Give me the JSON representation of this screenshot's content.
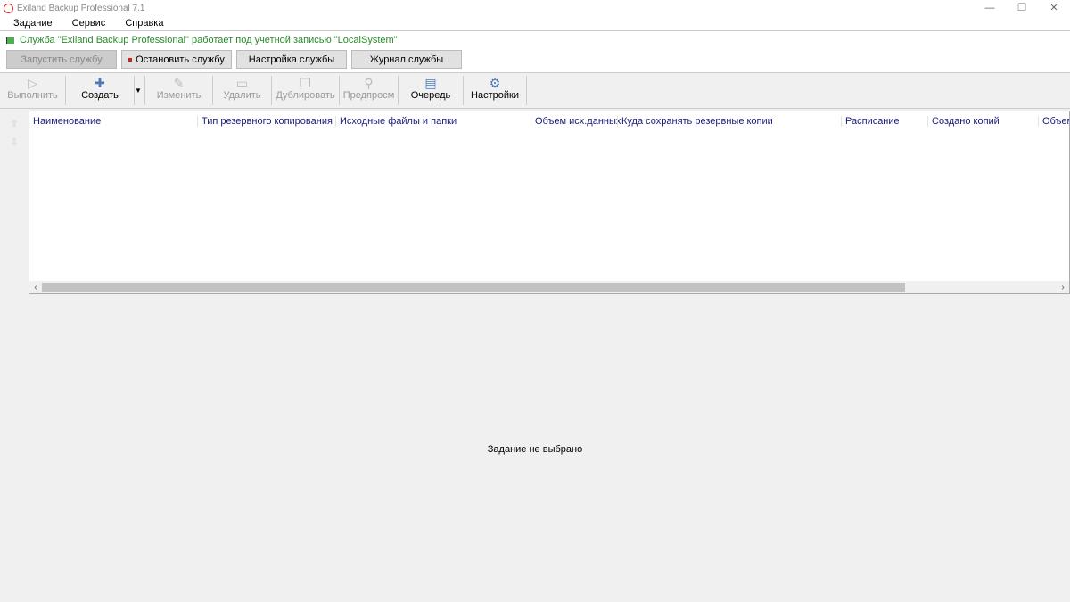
{
  "window": {
    "title": "Exiland Backup Professional 7.1",
    "controls": [
      "—",
      "❐",
      "✕"
    ]
  },
  "menu": [
    "Задание",
    "Сервис",
    "Справка"
  ],
  "service": {
    "message": "Служба \"Exiland Backup Professional\" работает под учетной записью \"LocalSystem\"",
    "buttons": {
      "start": "Запустить службу",
      "stop": "Остановить службу",
      "settings": "Настройка службы",
      "log": "Журнал службы"
    },
    "status_color": "#2a8a2a"
  },
  "toolbar": [
    {
      "label": "Выполнить",
      "icon": "▷",
      "enabled": false
    },
    {
      "label": "Создать",
      "icon": "✚",
      "enabled": true
    },
    {
      "label": "Изменить",
      "icon": "✎",
      "enabled": false
    },
    {
      "label": "Удалить",
      "icon": "▭",
      "enabled": false
    },
    {
      "label": "Дублировать",
      "icon": "❐",
      "enabled": false
    },
    {
      "label": "Предпросм",
      "icon": "⚲",
      "enabled": false
    },
    {
      "label": "Очередь",
      "icon": "▤",
      "enabled": true
    },
    {
      "label": "Настройки",
      "icon": "⚙",
      "enabled": true
    }
  ],
  "columns": [
    "Наименование",
    "Тип резервного копирования",
    "Исходные файлы и папки",
    "Объем исх.данных",
    "Куда сохранять резервные копии",
    "Расписание",
    "Создано копий",
    "Объем"
  ],
  "empty_message": "Задание не выбрано"
}
